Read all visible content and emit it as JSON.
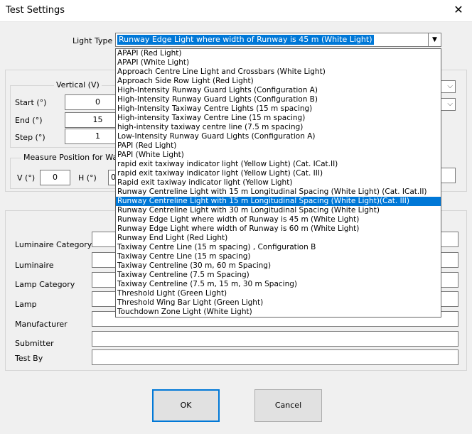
{
  "window": {
    "title": "Test Settings",
    "close_glyph": "✕"
  },
  "light_type": {
    "label": "Light Type",
    "selected": "Runway Edge Light where width of Runway is 45 m (White Light)",
    "options": [
      "APAPI (Red Light)",
      "APAPI (White Light)",
      "Approach Centre Line Light and Crossbars (White Light)",
      "Approach Side Row Light (Red Light)",
      "High-Intensity Runway Guard Lights (Configuration A)",
      "High-Intensity Runway Guard Lights (Configuration B)",
      "High-Intensity Taxiway Centre Lights (15 m spacing)",
      "High-intensity Taxiway Centre Line (15 m spacing)",
      "high-intensity taxiway centre line (7.5 m spacing)",
      "Low-Intensity Runway Guard Lights (Configuration A)",
      "PAPI (Red Light)",
      "PAPI (White Light)",
      "rapid exit taxiway indicator light (Yellow Light) (Cat. ICat.II)",
      "rapid exit taxiway indicator light (Yellow Light) (Cat. III)",
      "Rapid exit taxiway indicator light (Yellow Light)",
      "Runway Centreline Light with 15 m Longitudinal Spacing (White Light) (Cat. ICat.II)",
      "Runway Centreline Light with 15 m Longitudinal Spacing (White Light)(Cat. III)",
      "Runway Centreline Light with 30 m Longitudinal Spacing (White Light)",
      "Runway Edge Light where width of Runway is 45 m (White Light)",
      "Runway Edge Light where width of Runway is 60 m (White Light)",
      "Runway End Light (Red Light)",
      "Taxiway Centre Line (15 m spacing) , Configuration B",
      "Taxiway Centre Line (15 m spacing)",
      "Taxiway Centreline (30 m, 60 m Spacing)",
      "Taxiway Centreline (7.5 m Spacing)",
      "Taxiway Centreline (7.5 m, 15 m, 30 m Spacing)",
      "Threshold Light (Green Light)",
      "Threshold Wing Bar Light (Green Light)",
      "Touchdown Zone Light (White Light)"
    ],
    "highlighted_index": 16
  },
  "vertical": {
    "title": "Vertical (V)",
    "start_label": "Start (°)",
    "start_value": "0",
    "end_label": "End (°)",
    "end_value": "15",
    "step_label": "Step (°)",
    "step_value": "1"
  },
  "measure_position": {
    "title": "Measure Position for Warm",
    "v_label": "V (°)",
    "v_value": "0",
    "h_label": "H (°)",
    "h_value_partial": "0"
  },
  "info_fields": {
    "luminaire_category": "Luminaire Category",
    "luminaire": "Luminaire",
    "lamp_category": "Lamp Category",
    "lamp": "Lamp",
    "manufacturer": "Manufacturer",
    "submitter": "Submitter",
    "test_by": "Test By"
  },
  "buttons": {
    "ok": "OK",
    "cancel": "Cancel"
  },
  "colors": {
    "selection": "#0078d7",
    "dialog_bg": "#f0f0f0"
  }
}
